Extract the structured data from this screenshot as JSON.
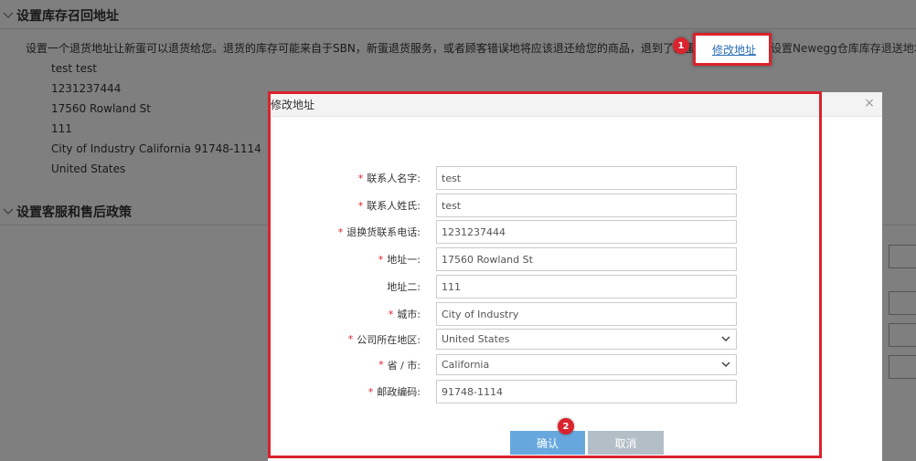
{
  "page": {
    "section1_title": "设置库存召回地址",
    "info_text_before": "设置一个退货地址让新蛋可以退货给您。退货的库存可能来自于SBN，新蛋退货服务，或者顾客错误地将应该退还给您的商品，退到了新蛋仓库。",
    "edit_link": "修改地址",
    "info_text_after": "设置Newegg仓库库存退送地址。",
    "address_lines": [
      "test test",
      "1231237444",
      "17560 Rowland St",
      "111",
      "City of Industry California 91748-1114",
      "United States"
    ],
    "section2_title": "设置客服和售后政策"
  },
  "annotations": {
    "badge1": "1",
    "badge2": "2"
  },
  "modal": {
    "title": "修改地址",
    "close": "×",
    "fields": [
      {
        "label": "联系人名字:",
        "required": "*",
        "value": "test"
      },
      {
        "label": "联系人姓氏:",
        "required": "*",
        "value": "test"
      },
      {
        "label": "退换货联系电话:",
        "required": "*",
        "value": "1231237444"
      },
      {
        "label": "地址一:",
        "required": "*",
        "value": "17560 Rowland St"
      },
      {
        "label": "地址二:",
        "required": "",
        "value": "111"
      },
      {
        "label": "城市:",
        "required": "*",
        "value": "City of Industry"
      },
      {
        "label": "公司所在地区:",
        "required": "*",
        "value": "United States"
      },
      {
        "label": "省 / 市:",
        "required": "*",
        "value": "California"
      },
      {
        "label": "邮政编码:",
        "required": "*",
        "value": "91748-1114"
      }
    ],
    "confirm_label": "确认",
    "cancel_label": "取消"
  },
  "colors": {
    "highlight": "#d9232d",
    "link": "#2a6fb5",
    "confirm": "#66a8de",
    "cancel": "#b3bec6"
  }
}
